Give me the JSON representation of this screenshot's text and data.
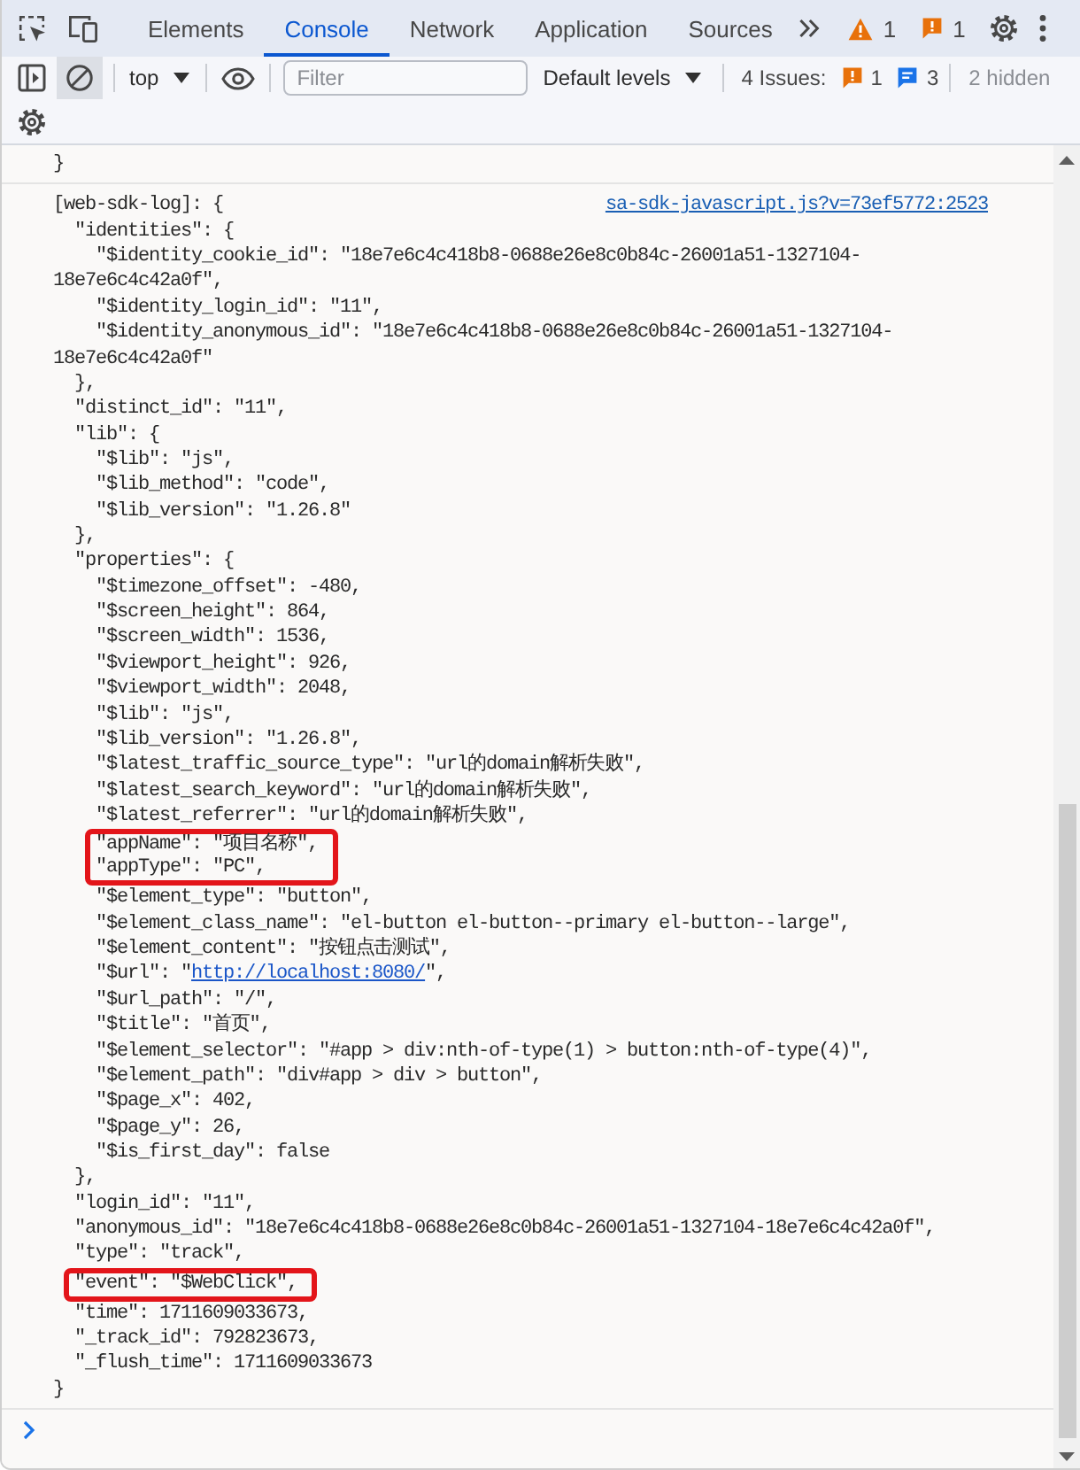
{
  "tab_bar": {
    "tabs": [
      {
        "label": "Elements",
        "selected": false
      },
      {
        "label": "Console",
        "selected": true
      },
      {
        "label": "Network",
        "selected": false
      },
      {
        "label": "Application",
        "selected": false
      },
      {
        "label": "Sources",
        "selected": false
      }
    ],
    "warnings": "1",
    "errors": "1"
  },
  "console_toolbar": {
    "context": "top",
    "filter": {
      "placeholder": "Filter"
    },
    "levels": "Default levels",
    "issues": {
      "label": "4 Issues:",
      "counts": [
        {
          "kind": "error",
          "count": "1"
        },
        {
          "kind": "info",
          "count": "3"
        }
      ]
    },
    "hidden": "2 hidden"
  },
  "console": {
    "messages": [
      {
        "lines": [
          {
            "kind": "value",
            "text": "}"
          }
        ]
      },
      {
        "source": "sa-sdk-javascript.js?v=73ef5772:2523",
        "lines": [
          {
            "kind": "object",
            "text": "[web-sdk-log]: {",
            "close": "}",
            "children": [
              {
                "kind": "object",
                "text": "\"identities\": {",
                "close": "},",
                "children": [
                  {
                    "kind": "value",
                    "text": "\"$identity_cookie_id\": \"18e7e6c4c418b8-0688e26e8c0b84c-26001a51-1327104-18e7e6c4c42a0f\","
                  },
                  {
                    "kind": "value",
                    "text": "\"$identity_login_id\": \"11\","
                  },
                  {
                    "kind": "value",
                    "text": "\"$identity_anonymous_id\": \"18e7e6c4c418b8-0688e26e8c0b84c-26001a51-1327104-18e7e6c4c42a0f\""
                  }
                ]
              },
              {
                "kind": "value",
                "text": "\"distinct_id\": \"11\","
              },
              {
                "kind": "object",
                "text": "\"lib\": {",
                "close": "},",
                "children": [
                  {
                    "kind": "value",
                    "text": "\"$lib\": \"js\","
                  },
                  {
                    "kind": "value",
                    "text": "\"$lib_method\": \"code\","
                  },
                  {
                    "kind": "value",
                    "text": "\"$lib_version\": \"1.26.8\""
                  }
                ]
              },
              {
                "kind": "object",
                "text": "\"properties\": {",
                "close": "},",
                "children": [
                  {
                    "kind": "value",
                    "text": "\"$timezone_offset\": -480,"
                  },
                  {
                    "kind": "value",
                    "text": "\"$screen_height\": 864,"
                  },
                  {
                    "kind": "value",
                    "text": "\"$screen_width\": 1536,"
                  },
                  {
                    "kind": "value",
                    "text": "\"$viewport_height\": 926,"
                  },
                  {
                    "kind": "value",
                    "text": "\"$viewport_width\": 2048,"
                  },
                  {
                    "kind": "value",
                    "text": "\"$lib\": \"js\","
                  },
                  {
                    "kind": "value",
                    "text": "\"$lib_version\": \"1.26.8\","
                  },
                  {
                    "kind": "value",
                    "text": "\"$latest_traffic_source_type\": \"url的domain解析失败\","
                  },
                  {
                    "kind": "value",
                    "text": "\"$latest_search_keyword\": \"url的domain解析失败\","
                  },
                  {
                    "kind": "value",
                    "text": "\"$latest_referrer\": \"url的domain解析失败\","
                  },
                  {
                    "kind": "highlight",
                    "lines": [
                      {
                        "kind": "value",
                        "text": "\"appName\": \"项目名称\","
                      },
                      {
                        "kind": "value",
                        "text": "\"appType\": \"PC\","
                      }
                    ]
                  },
                  {
                    "kind": "value",
                    "text": "\"$element_type\": \"button\","
                  },
                  {
                    "kind": "value",
                    "text": "\"$element_class_name\": \"el-button el-button--primary el-button--large\","
                  },
                  {
                    "kind": "value",
                    "text": "\"$element_content\": \"按钮点击测试\","
                  },
                  {
                    "kind": "link",
                    "text": "\"$url\": \"",
                    "link": "http://localhost:8080/",
                    "tail": "\","
                  },
                  {
                    "kind": "value",
                    "text": "\"$url_path\": \"/\","
                  },
                  {
                    "kind": "value",
                    "text": "\"$title\": \"首页\","
                  },
                  {
                    "kind": "value",
                    "text": "\"$element_selector\": \"#app > div:nth-of-type(1) > button:nth-of-type(4)\","
                  },
                  {
                    "kind": "value",
                    "text": "\"$element_path\": \"div#app > div > button\","
                  },
                  {
                    "kind": "value",
                    "text": "\"$page_x\": 402,"
                  },
                  {
                    "kind": "value",
                    "text": "\"$page_y\": 26,"
                  },
                  {
                    "kind": "value",
                    "text": "\"$is_first_day\": false"
                  }
                ]
              },
              {
                "kind": "value",
                "text": "\"login_id\": \"11\","
              },
              {
                "kind": "value",
                "text": "\"anonymous_id\": \"18e7e6c4c418b8-0688e26e8c0b84c-26001a51-1327104-18e7e6c4c42a0f\","
              },
              {
                "kind": "value",
                "text": "\"type\": \"track\","
              },
              {
                "kind": "highlight",
                "lines": [
                  {
                    "kind": "value",
                    "text": "\"event\": \"$WebClick\","
                  }
                ]
              },
              {
                "kind": "value",
                "text": "\"time\": 1711609033673,"
              },
              {
                "kind": "value",
                "text": "\"_track_id\": 792823673,"
              },
              {
                "kind": "value",
                "text": "\"_flush_time\": 1711609033673"
              }
            ]
          }
        ]
      }
    ]
  }
}
